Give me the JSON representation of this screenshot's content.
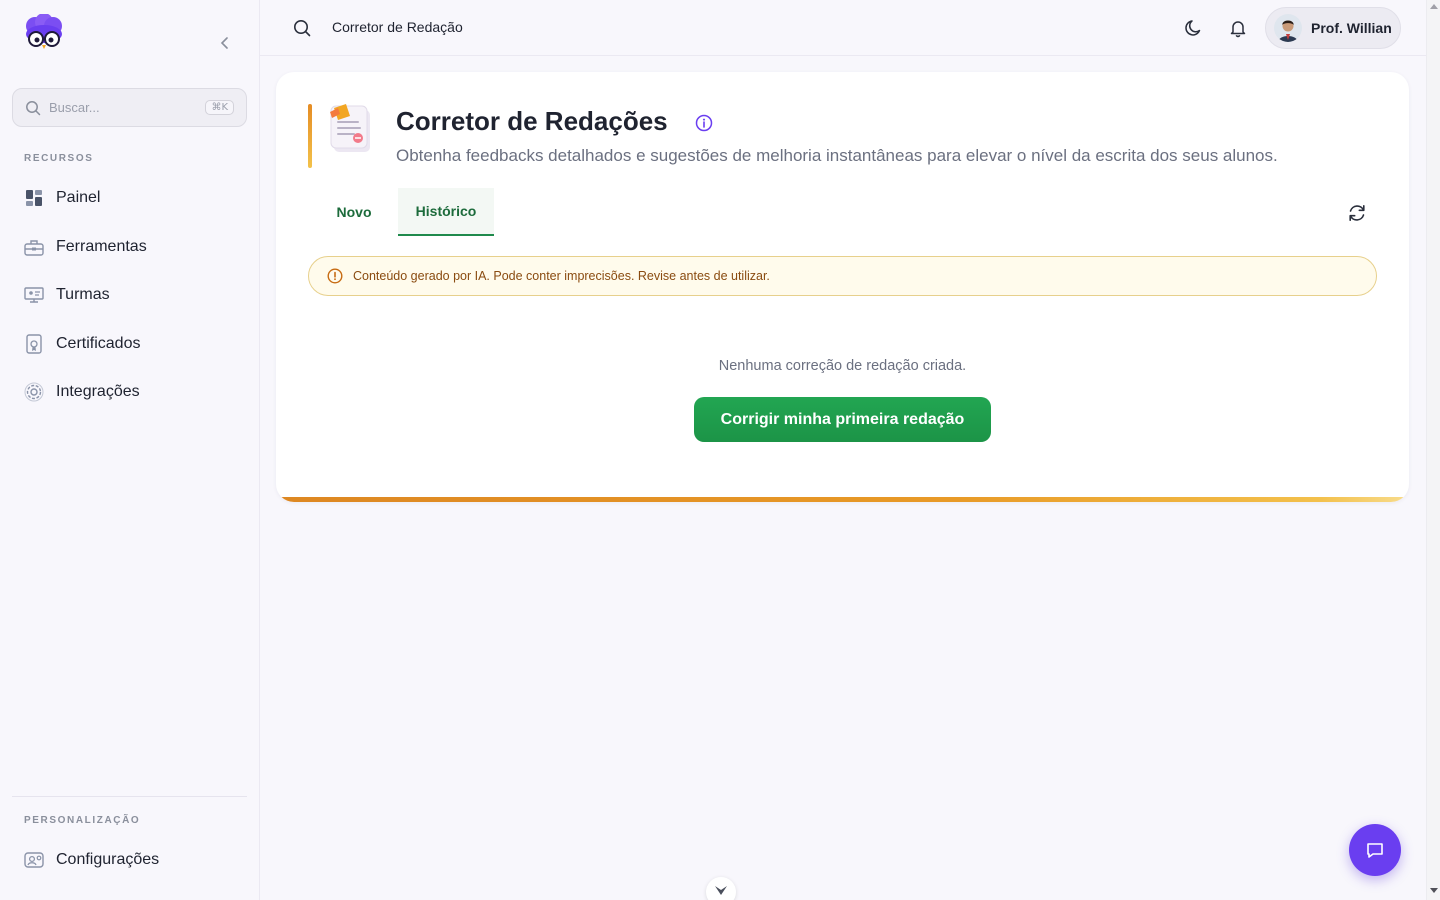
{
  "sidebar": {
    "logo_icon": "owl-logo-icon",
    "collapse_icon": "chevron-left-icon",
    "search": {
      "placeholder": "Buscar...",
      "shortcut": "⌘K"
    },
    "section_resources": "RECURSOS",
    "items": [
      {
        "label": "Painel",
        "icon": "dashboard-icon"
      },
      {
        "label": "Ferramentas",
        "icon": "toolbox-icon"
      },
      {
        "label": "Turmas",
        "icon": "classroom-icon"
      },
      {
        "label": "Certificados",
        "icon": "certificate-icon"
      },
      {
        "label": "Integrações",
        "icon": "gear-icon"
      }
    ],
    "section_personalization": "PERSONALIZAÇÃO",
    "settings": {
      "label": "Configurações",
      "icon": "user-settings-icon"
    }
  },
  "topbar": {
    "title": "Corretor de Redação",
    "user_name": "Prof. Willian"
  },
  "page": {
    "title": "Corretor de Redações",
    "subtitle": "Obtenha feedbacks detalhados e sugestões de melhoria instantâneas para elevar o nível da escrita dos seus alunos.",
    "tabs": [
      {
        "label": "Novo",
        "active": false
      },
      {
        "label": "Histórico",
        "active": true
      }
    ],
    "alert": "Conteúdo gerado por IA. Pode conter imprecisões. Revise antes de utilizar.",
    "empty_text": "Nenhuma correção de redação criada.",
    "cta_label": "Corrigir minha primeira redação"
  },
  "colors": {
    "brand_purple": "#6a3ef0",
    "primary_green": "#1f9a4b",
    "accent_orange": "#e58c24",
    "alert_bg": "#fffbec"
  }
}
